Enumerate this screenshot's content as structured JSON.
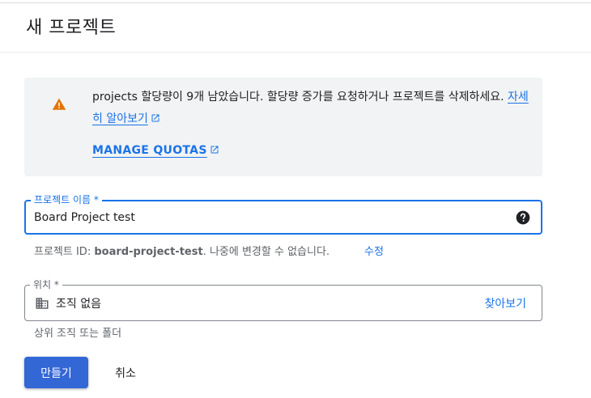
{
  "header": {
    "title": "새 프로젝트"
  },
  "quota_notice": {
    "text_before_link": "projects 할당량이 9개 남았습니다. 할당량 증가를 요청하거나 프로젝트를 삭제하세요. ",
    "learn_more_label": "자세히 알아보기",
    "manage_quotas_label": "MANAGE QUOTAS",
    "icon": "warning-icon",
    "icon_color": "#e37400"
  },
  "project_name": {
    "label": "프로젝트 이름 *",
    "value": "Board Project test",
    "help_icon": "help-circle-icon"
  },
  "project_id": {
    "prefix": "프로젝트 ID: ",
    "id": "board-project-test",
    "suffix": ". 나중에 변경할 수 없습니다.",
    "edit_label": "수정"
  },
  "location": {
    "label": "위치 *",
    "value": "조직 없음",
    "browse_label": "찾아보기",
    "hint": "상위 조직 또는 폴더",
    "icon": "building-icon"
  },
  "actions": {
    "create_label": "만들기",
    "cancel_label": "취소",
    "primary_color": "#3367d6"
  }
}
